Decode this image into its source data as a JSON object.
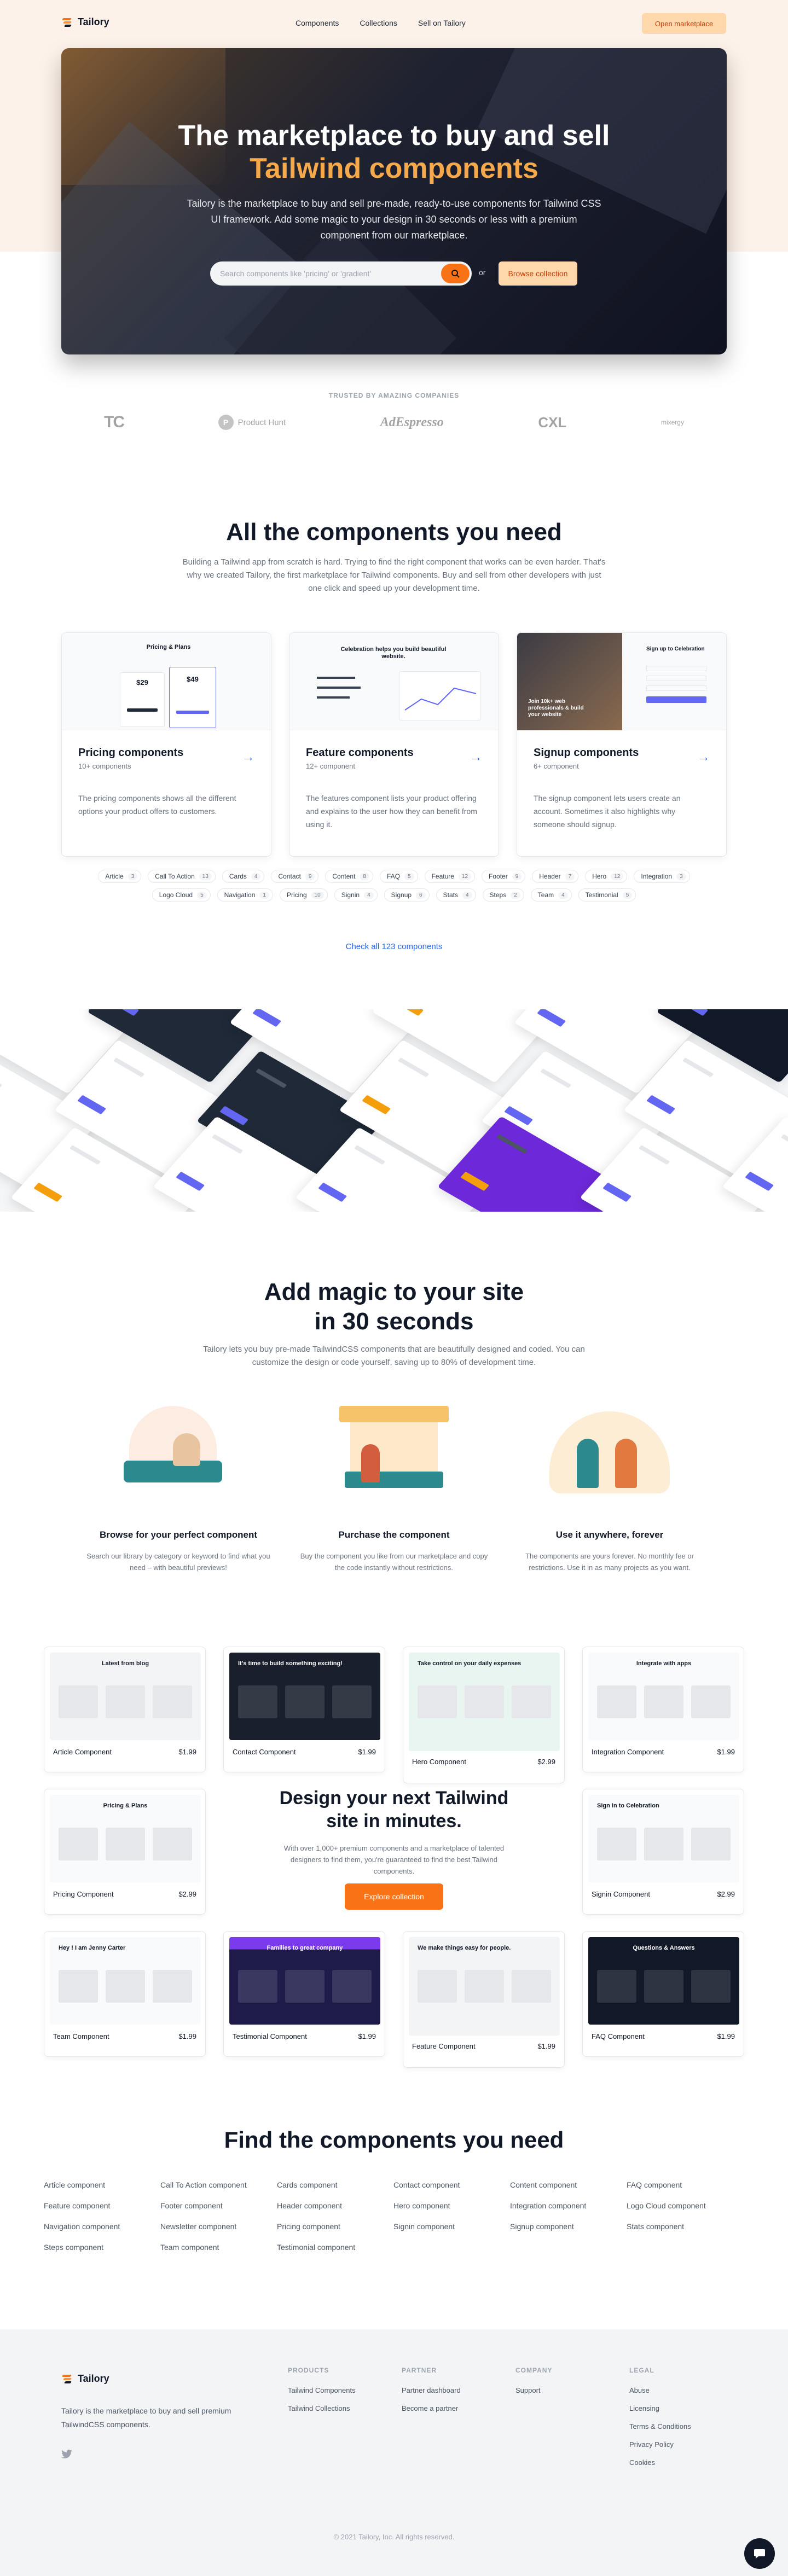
{
  "brand": {
    "name": "Tailory"
  },
  "nav": {
    "links": [
      "Components",
      "Collections",
      "Sell on Tailory"
    ],
    "cta": "Open marketplace"
  },
  "hero": {
    "title_line1": "The marketplace to buy and sell",
    "title_line2": "Tailwind components",
    "subtitle": "Tailory is the marketplace to buy and sell pre-made, ready-to-use components for Tailwind CSS UI framework. Add some magic to your design in 30 seconds or less with a premium component from our marketplace.",
    "search_placeholder": "Search components like 'pricing' or 'gradient'",
    "or_text": "or",
    "browse_label": "Browse collection"
  },
  "trusted": {
    "label": "TRUSTED BY AMAZING COMPANIES",
    "logos": [
      "TC",
      "Product Hunt",
      "AdEspresso",
      "CXL",
      "mixergy"
    ]
  },
  "components": {
    "title": "All the components you need",
    "subtitle": "Building a Tailwind app from scratch is hard. Trying to find the right component that works can be even harder. That's why we created Tailory, the first marketplace for Tailwind components. Buy and sell from other developers with just one click and speed up your development time.",
    "cards": [
      {
        "title": "Pricing components",
        "count": "10+ components",
        "desc": "The pricing components shows all the different options your product offers to customers.",
        "thumb_title": "Pricing & Plans",
        "prices": [
          "$29",
          "$49"
        ]
      },
      {
        "title": "Feature components",
        "count": "12+ component",
        "desc": "The features component lists your product offering and explains to the user how they can benefit from using it.",
        "thumb_title": "Celebration helps you build beautiful website."
      },
      {
        "title": "Signup components",
        "count": "6+ component",
        "desc": "The signup component lets users create an account. Sometimes it also highlights why someone should signup.",
        "thumb_title": "Sign up to Celebration",
        "thumb_caption": "Join 10k+ web professionals & build your website"
      }
    ],
    "chips": [
      {
        "label": "Article",
        "count": "3"
      },
      {
        "label": "Call To Action",
        "count": "13"
      },
      {
        "label": "Cards",
        "count": "4"
      },
      {
        "label": "Contact",
        "count": "9"
      },
      {
        "label": "Content",
        "count": "8"
      },
      {
        "label": "FAQ",
        "count": "5"
      },
      {
        "label": "Feature",
        "count": "12"
      },
      {
        "label": "Footer",
        "count": "9"
      },
      {
        "label": "Header",
        "count": "7"
      },
      {
        "label": "Hero",
        "count": "12"
      },
      {
        "label": "Integration",
        "count": "3"
      },
      {
        "label": "Logo Cloud",
        "count": "5"
      },
      {
        "label": "Navigation",
        "count": "1"
      },
      {
        "label": "Pricing",
        "count": "10"
      },
      {
        "label": "Signin",
        "count": "4"
      },
      {
        "label": "Signup",
        "count": "6"
      },
      {
        "label": "Stats",
        "count": "4"
      },
      {
        "label": "Steps",
        "count": "2"
      },
      {
        "label": "Team",
        "count": "4"
      },
      {
        "label": "Testimonial",
        "count": "5"
      }
    ],
    "check_all": "Check all 123 components"
  },
  "magic": {
    "title_line1": "Add magic to your site",
    "title_line2": "in 30 seconds",
    "subtitle": "Tailory lets you buy pre-made TailwindCSS components that are beautifully designed and coded. You can customize the design or code yourself, saving up to 80% of development time.",
    "steps": [
      {
        "title": "Browse for your perfect component",
        "desc": "Search our library by category or keyword to find what you need – with beautiful previews!"
      },
      {
        "title": "Purchase the component",
        "desc": "Buy the component you like from our marketplace and copy the code instantly without restrictions."
      },
      {
        "title": "Use it anywhere, forever",
        "desc": "The components are yours forever. No monthly fee or restrictions. Use it in as many projects as you want."
      }
    ]
  },
  "products": {
    "items": [
      {
        "name": "Article Component",
        "price": "$1.99",
        "preview_text": "Latest from blog"
      },
      {
        "name": "Contact Component",
        "price": "$1.99",
        "preview_text": "It's time to build something exciting!"
      },
      {
        "name": "Hero Component",
        "price": "$2.99",
        "preview_text": "Take control on your daily expenses"
      },
      {
        "name": "Integration Component",
        "price": "$1.99",
        "preview_text": "Integrate with apps"
      },
      {
        "name": "Pricing Component",
        "price": "$2.99",
        "preview_text": "Pricing & Plans"
      },
      {
        "name": "Signin Component",
        "price": "$2.99",
        "preview_text": "Sign in to Celebration"
      },
      {
        "name": "Team Component",
        "price": "$1.99",
        "preview_text": "Hey ! I am Jenny Carter"
      },
      {
        "name": "Testimonial Component",
        "price": "$1.99",
        "preview_text": "Families to great company"
      },
      {
        "name": "Feature Component",
        "price": "$1.99",
        "preview_text": "We make things easy for people."
      },
      {
        "name": "FAQ Component",
        "price": "$1.99",
        "preview_text": "Questions & Answers"
      }
    ],
    "center_title_line1": "Design your next Tailwind",
    "center_title_line2": "site in minutes.",
    "center_desc": "With over 1,000+ premium components and a marketplace of talented designers to find them, you're guaranteed to find the best Tailwind components.",
    "center_cta": "Explore collection"
  },
  "find": {
    "title": "Find the components you need",
    "links": [
      "Article component",
      "Call To Action component",
      "Cards component",
      "Contact component",
      "Content component",
      "FAQ component",
      "Feature component",
      "Footer component",
      "Header component",
      "Hero component",
      "Integration component",
      "Logo Cloud component",
      "Navigation component",
      "Newsletter component",
      "Pricing component",
      "Signin component",
      "Signup component",
      "Stats component",
      "Steps component",
      "Team component",
      "Testimonial component"
    ]
  },
  "footer": {
    "tagline": "Tailory is the marketplace to buy and sell premium TailwindCSS components.",
    "columns": [
      {
        "heading": "PRODUCTS",
        "links": [
          "Tailwind Components",
          "Tailwind Collections"
        ]
      },
      {
        "heading": "PARTNER",
        "links": [
          "Partner dashboard",
          "Become a partner"
        ]
      },
      {
        "heading": "COMPANY",
        "links": [
          "Support"
        ]
      },
      {
        "heading": "LEGAL",
        "links": [
          "Abuse",
          "Licensing",
          "Terms & Conditions",
          "Privacy Policy",
          "Cookies"
        ]
      }
    ],
    "copyright": "© 2021 Tailory, Inc. All rights reserved."
  },
  "colors": {
    "accent": "#f97316",
    "accent_soft": "#fed7aa",
    "link": "#2563eb",
    "hero_highlight": "#f6a94a"
  }
}
